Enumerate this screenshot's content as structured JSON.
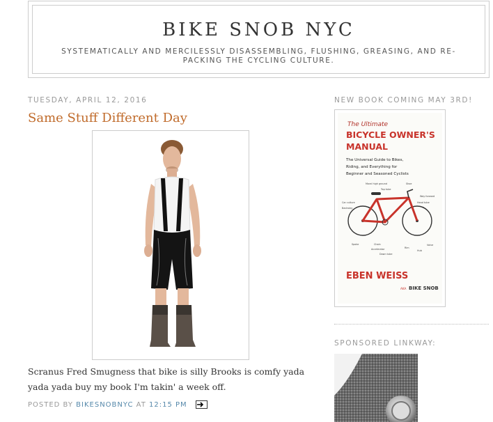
{
  "header": {
    "title": "BIKE SNOB NYC",
    "description": "SYSTEMATICALLY AND MERCILESSLY DISASSEMBLING, FLUSHING, GREASING, AND RE-PACKING THE CYCLING CULTURE."
  },
  "post": {
    "date": "TUESDAY, APRIL 12, 2016",
    "title": "Same Stuff Different Day",
    "body": "Scranus Fred Smugness that bike is silly Brooks is comfy yada yada yada buy my book I'm takin' a week off.",
    "footer": {
      "posted_by_label": "POSTED BY",
      "author": "BIKESNOBNYC",
      "at_label": "AT",
      "time": "12:15 PM"
    }
  },
  "sidebar": {
    "book_heading": "NEW BOOK COMING MAY 3RD!",
    "book": {
      "the_ultimate": "The Ultimate",
      "title_line1": "BICYCLE OWNER'S",
      "title_line2": "MANUAL",
      "subtitle_line1": "The Universal Guide to Bikes,",
      "subtitle_line2": "Riding, and Everything for",
      "subtitle_line3": "Beginner and Seasoned Cyclists",
      "labels": {
        "moral_high_ground": "Moral high ground",
        "shoe": "Shoe",
        "top_tube": "Top tube",
        "way_forward": "Way forward",
        "head_tube": "Head tube",
        "car_culture": "Car culture",
        "backstay": "Backstay",
        "spoke": "Spoke",
        "chain": "Chain",
        "accelerator": "Accelerator",
        "down_tube": "Down tube",
        "rim": "Rim",
        "hub": "Hub",
        "valve": "Valve"
      },
      "author": "EBEN WEISS",
      "aka_prefix": "AKA",
      "aka_name": "BIKE SNOB"
    },
    "sponsored_heading": "SPONSORED LINKWAY:"
  },
  "colors": {
    "title_orange": "#c06b2b",
    "link_blue": "#5588aa",
    "book_red": "#c8332b"
  }
}
